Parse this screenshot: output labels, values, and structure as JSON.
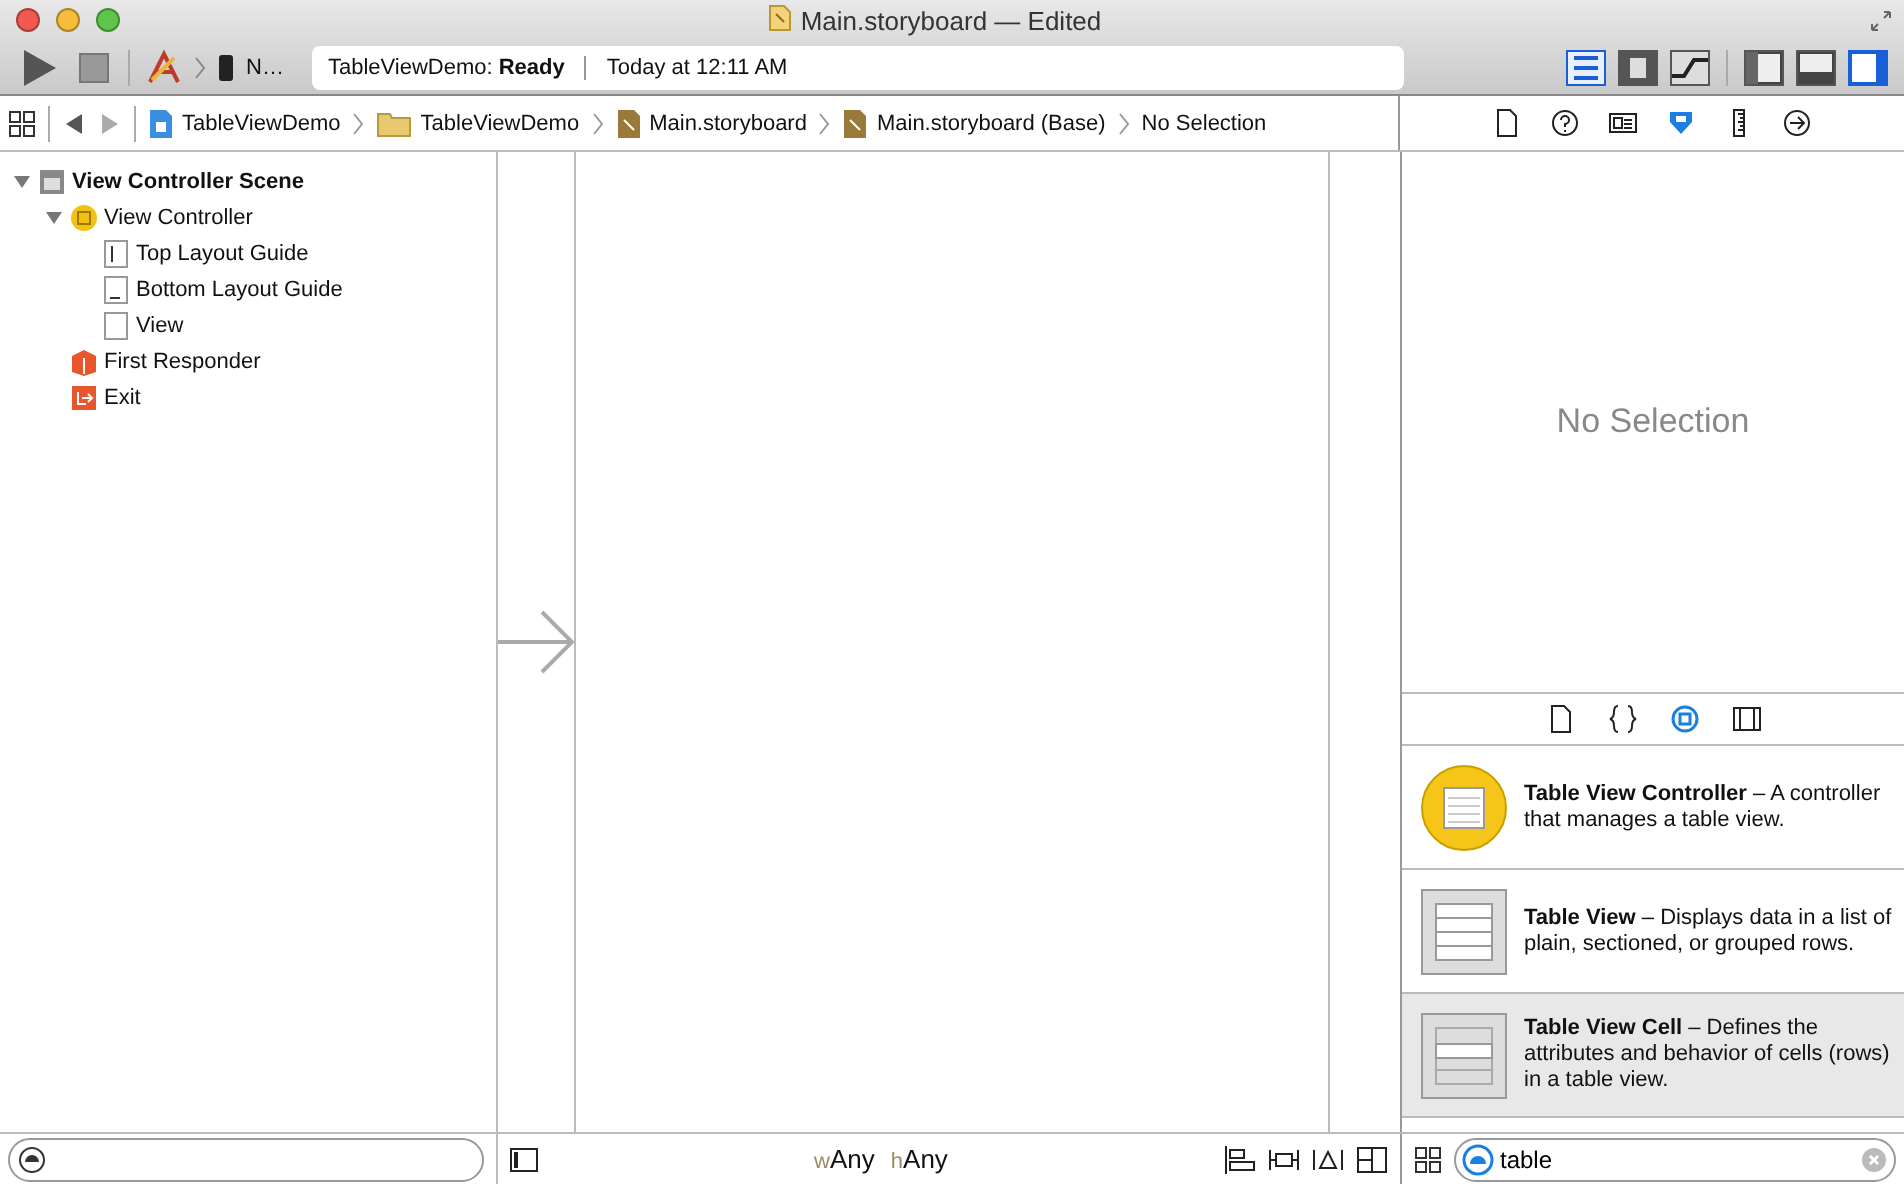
{
  "window": {
    "title": "Main.storyboard — Edited"
  },
  "toolbar": {
    "scheme": "N…",
    "activity": {
      "project": "TableViewDemo:",
      "status": "Ready",
      "time": "Today at 12:11 AM"
    },
    "editor_buttons": [
      {
        "kind": "standard",
        "selected": true
      },
      {
        "kind": "assistant",
        "selected": false
      },
      {
        "kind": "version",
        "selected": false
      }
    ],
    "view_buttons": [
      {
        "kind": "navigator",
        "selected": false
      },
      {
        "kind": "debug",
        "selected": false
      },
      {
        "kind": "utilities",
        "selected": true
      }
    ]
  },
  "jump_bar": [
    {
      "kind": "project",
      "label": "TableViewDemo"
    },
    {
      "kind": "folder",
      "label": "TableViewDemo"
    },
    {
      "kind": "storyboard",
      "label": "Main.storyboard"
    },
    {
      "kind": "storyboard",
      "label": "Main.storyboard (Base)"
    },
    {
      "kind": "none",
      "label": "No Selection"
    }
  ],
  "outline": [
    {
      "kind": "scene",
      "label": "View Controller Scene",
      "expanded": true,
      "children": [
        {
          "kind": "controller",
          "label": "View Controller",
          "expanded": true,
          "children": [
            {
              "kind": "top-guide",
              "label": "Top Layout Guide"
            },
            {
              "kind": "bottom-guide",
              "label": "Bottom Layout Guide"
            },
            {
              "kind": "view",
              "label": "View"
            }
          ]
        },
        {
          "kind": "responder",
          "label": "First Responder"
        },
        {
          "kind": "exit",
          "label": "Exit"
        }
      ]
    }
  ],
  "inspector": {
    "tabs": [
      {
        "kind": "file",
        "selected": false
      },
      {
        "kind": "help",
        "selected": false
      },
      {
        "kind": "identity",
        "selected": false
      },
      {
        "kind": "attributes",
        "selected": true
      },
      {
        "kind": "size",
        "selected": false
      },
      {
        "kind": "connections",
        "selected": false
      }
    ],
    "message": "No Selection"
  },
  "library": {
    "tabs": [
      {
        "kind": "file",
        "selected": false
      },
      {
        "kind": "code",
        "selected": false
      },
      {
        "kind": "object",
        "selected": true
      },
      {
        "kind": "media",
        "selected": false
      }
    ],
    "items": [
      {
        "kind": "controller",
        "text": "**Table View Controller** – A controller that manages a table view.",
        "selected": false
      },
      {
        "kind": "table",
        "text": "**Table View** – Displays data in a list of plain, sectioned, or grouped rows.",
        "selected": false
      },
      {
        "kind": "cell",
        "text": "**Table View Cell** – Defines the attributes and behavior of cells (rows) in a table view.",
        "selected": true
      }
    ],
    "search": {
      "value": "table"
    }
  },
  "size_class": [
    {
      "prefix": "w",
      "value": "Any"
    },
    {
      "prefix": "h",
      "value": "Any"
    }
  ]
}
